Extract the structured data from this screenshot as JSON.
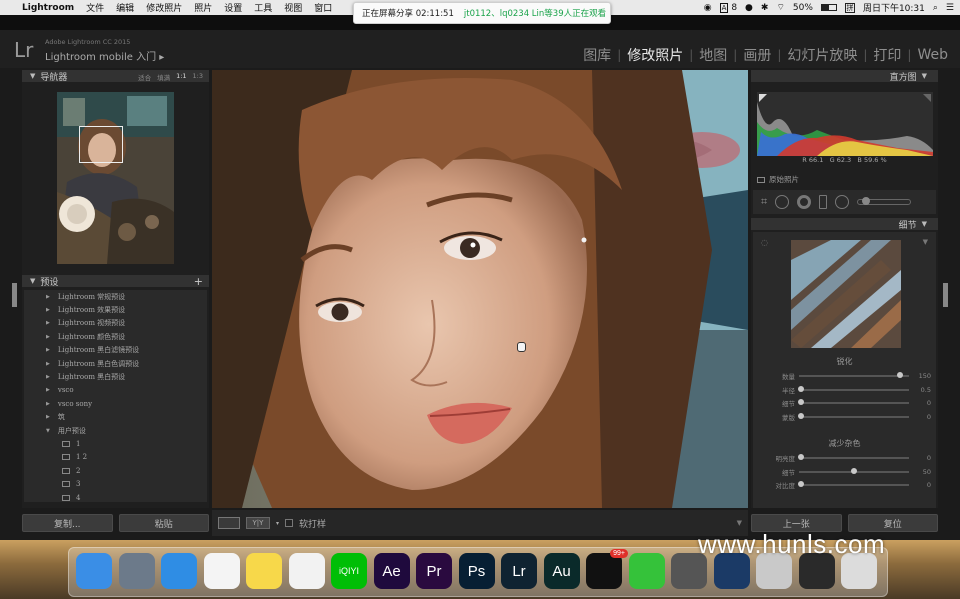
{
  "menubar": {
    "app_name": "Lightroom",
    "menus": [
      "文件",
      "编辑",
      "修改照片",
      "照片",
      "设置",
      "工具",
      "视图",
      "窗口"
    ],
    "ai_label": "A",
    "ai_count": "8",
    "battery": "50%",
    "datetime": "周日下午10:31"
  },
  "share_banner": {
    "status": "正在屏幕分享 02:11:51",
    "viewers": "jt0112、lq0234 Lin等39人正在观看"
  },
  "identity": {
    "logo": "Lr",
    "product": "Adobe Lightroom CC 2015",
    "mobile": "Lightroom mobile 入门 ▸"
  },
  "modules": [
    {
      "label": "图库",
      "active": false
    },
    {
      "label": "修改照片",
      "active": true
    },
    {
      "label": "地图",
      "active": false
    },
    {
      "label": "画册",
      "active": false
    },
    {
      "label": "幻灯片放映",
      "active": false
    },
    {
      "label": "打印",
      "active": false
    },
    {
      "label": "Web",
      "active": false
    }
  ],
  "navigator": {
    "title": "导航器",
    "options": [
      "适合",
      "填满",
      "1:1",
      "1:3"
    ]
  },
  "presets": {
    "title": "预设",
    "items": [
      {
        "label": "Lightroom 常规预设",
        "sub": false,
        "icon": "disclosure-right"
      },
      {
        "label": "Lightroom 效果预设",
        "sub": false,
        "icon": "disclosure-right"
      },
      {
        "label": "Lightroom 视频预设",
        "sub": false,
        "icon": "disclosure-right"
      },
      {
        "label": "Lightroom 颜色预设",
        "sub": false,
        "icon": "disclosure-right"
      },
      {
        "label": "Lightroom 黑白滤镜预设",
        "sub": false,
        "icon": "disclosure-right"
      },
      {
        "label": "Lightroom 黑白色调预设",
        "sub": false,
        "icon": "disclosure-right"
      },
      {
        "label": "Lightroom 黑白预设",
        "sub": false,
        "icon": "disclosure-right"
      },
      {
        "label": "vsco",
        "sub": false,
        "icon": "disclosure-right"
      },
      {
        "label": "vsco sony",
        "sub": false,
        "icon": "disclosure-right"
      },
      {
        "label": "筑",
        "sub": false,
        "icon": "disclosure-right"
      },
      {
        "label": "用户预设",
        "sub": false,
        "icon": "disclosure-down"
      },
      {
        "label": "1",
        "sub": true,
        "icon": "preset"
      },
      {
        "label": "1 2",
        "sub": true,
        "icon": "preset"
      },
      {
        "label": "2",
        "sub": true,
        "icon": "preset"
      },
      {
        "label": "3",
        "sub": true,
        "icon": "preset"
      },
      {
        "label": "4",
        "sub": true,
        "icon": "preset"
      }
    ]
  },
  "left_buttons": {
    "copy": "复制...",
    "paste": "粘贴"
  },
  "toolbar": {
    "soft_proof": "软打样",
    "compare": "Y|Y"
  },
  "histogram": {
    "title": "直方图",
    "r_label": "R",
    "r_value": "66.1",
    "g_label": "G",
    "g_value": "62.3",
    "b_label": "B",
    "b_value": "59.6",
    "pct": "%",
    "original_photo": "原始照片"
  },
  "detail": {
    "title": "细节",
    "sharpen": {
      "title": "锐化",
      "sliders": [
        {
          "label": "数量",
          "level": 0.92,
          "value": "150"
        },
        {
          "label": "半径",
          "level": 0.02,
          "value": "0.5"
        },
        {
          "label": "细节",
          "level": 0.02,
          "value": "0"
        },
        {
          "label": "蒙版",
          "level": 0.02,
          "value": "0"
        }
      ]
    },
    "noise": {
      "title": "减少杂色",
      "sliders": [
        {
          "label": "明亮度",
          "level": 0.02,
          "value": "0"
        },
        {
          "label": "细节",
          "level": 0.5,
          "value": "50"
        },
        {
          "label": "对比度",
          "level": 0.02,
          "value": "0"
        }
      ]
    }
  },
  "right_buttons": {
    "previous": "上一张",
    "reset": "复位"
  },
  "dock": {
    "apps": [
      {
        "name": "finder-icon",
        "label": "",
        "color": "#3a8ee6"
      },
      {
        "name": "launchpad-icon",
        "label": "",
        "color": "#6c7a8a"
      },
      {
        "name": "safari-icon",
        "label": "",
        "color": "#2f8de4"
      },
      {
        "name": "reminders-icon",
        "label": "",
        "color": "#f4f4f4"
      },
      {
        "name": "notes-icon",
        "label": "",
        "color": "#f7d84a"
      },
      {
        "name": "photos-icon",
        "label": "",
        "color": "#f2f2f2"
      },
      {
        "name": "iqiyi-icon",
        "label": "iQIYI",
        "color": "#00be06"
      },
      {
        "name": "after-effects-icon",
        "label": "Ae",
        "color": "#1f0a3d"
      },
      {
        "name": "premiere-icon",
        "label": "Pr",
        "color": "#2a0a3f"
      },
      {
        "name": "photoshop-icon",
        "label": "Ps",
        "color": "#071f33"
      },
      {
        "name": "lightroom-icon",
        "label": "Lr",
        "color": "#0f2331"
      },
      {
        "name": "audition-icon",
        "label": "Au",
        "color": "#0a2a2a"
      },
      {
        "name": "qq-icon",
        "label": "",
        "color": "#111111"
      },
      {
        "name": "wechat-icon",
        "label": "",
        "color": "#35c23a"
      },
      {
        "name": "image-capture-icon",
        "label": "",
        "color": "#555555"
      },
      {
        "name": "quicktime-icon",
        "label": "",
        "color": "#1b3a66"
      },
      {
        "name": "folder-stack-icon",
        "label": "",
        "color": "#c9c9c9"
      },
      {
        "name": "screenshot-stack-icon",
        "label": "",
        "color": "#2a2a2a"
      },
      {
        "name": "trash-icon",
        "label": "",
        "color": "#dcdcdc"
      }
    ],
    "qq_badge": "99+"
  },
  "watermark": "www.hunls.com",
  "colors": {
    "accent": "#e8e8e8",
    "panel": "#2b2b2b",
    "viewers": "#1aa34a"
  }
}
